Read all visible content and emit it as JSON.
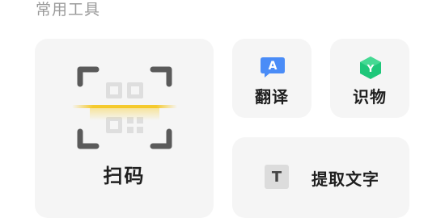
{
  "section_title": "常用工具",
  "tools": {
    "scan": {
      "label": "扫码",
      "icon": "qr-scan-icon"
    },
    "translate": {
      "label": "翻译",
      "icon": "translate-icon",
      "icon_letter": "A",
      "icon_color": "#4a8cf7"
    },
    "recognize": {
      "label": "识物",
      "icon": "object-recognition-icon",
      "icon_letter": "Y",
      "icon_color": "#1fc77a"
    },
    "ocr": {
      "label": "提取文字",
      "icon": "text-extract-icon",
      "icon_letter": "T"
    }
  },
  "colors": {
    "tile_bg": "#f5f5f5",
    "scan_line": "#f5c518",
    "bracket": "#5a5a5a"
  }
}
